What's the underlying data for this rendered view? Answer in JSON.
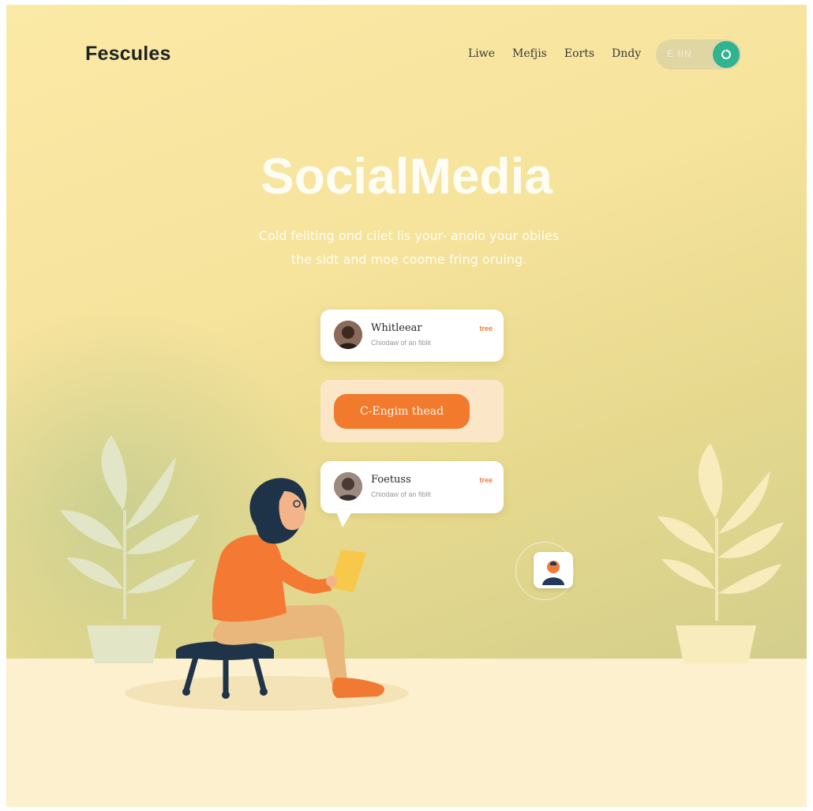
{
  "brand": {
    "logo": "Fescules"
  },
  "nav": {
    "items": [
      {
        "label": "Liwe"
      },
      {
        "label": "Mefjis"
      },
      {
        "label": "Eorts"
      },
      {
        "label": "Dndy"
      }
    ],
    "toggle": {
      "label": "E IIN",
      "icon": "refresh-icon",
      "color": "#2fb391"
    }
  },
  "hero": {
    "title": "SocialMedia",
    "subtitle_line1": "Cold feliting ond ciiet lis your- anoio your obiles",
    "subtitle_line2": "the sidt and moe coome fring oruing."
  },
  "cards": [
    {
      "name": "Whitleear",
      "sub": "Chiodaw of an fiblit",
      "badge": "tree"
    },
    {
      "name": "Foetuss",
      "sub": "Chiodaw of an fiblit",
      "badge": "tree"
    }
  ],
  "cta": {
    "label": "C-Engim thead",
    "color": "#f27a2d"
  },
  "colors": {
    "accent": "#f27a2d",
    "teal": "#2fb391",
    "background": "#f6e39c",
    "floor": "#fcf0cf"
  }
}
